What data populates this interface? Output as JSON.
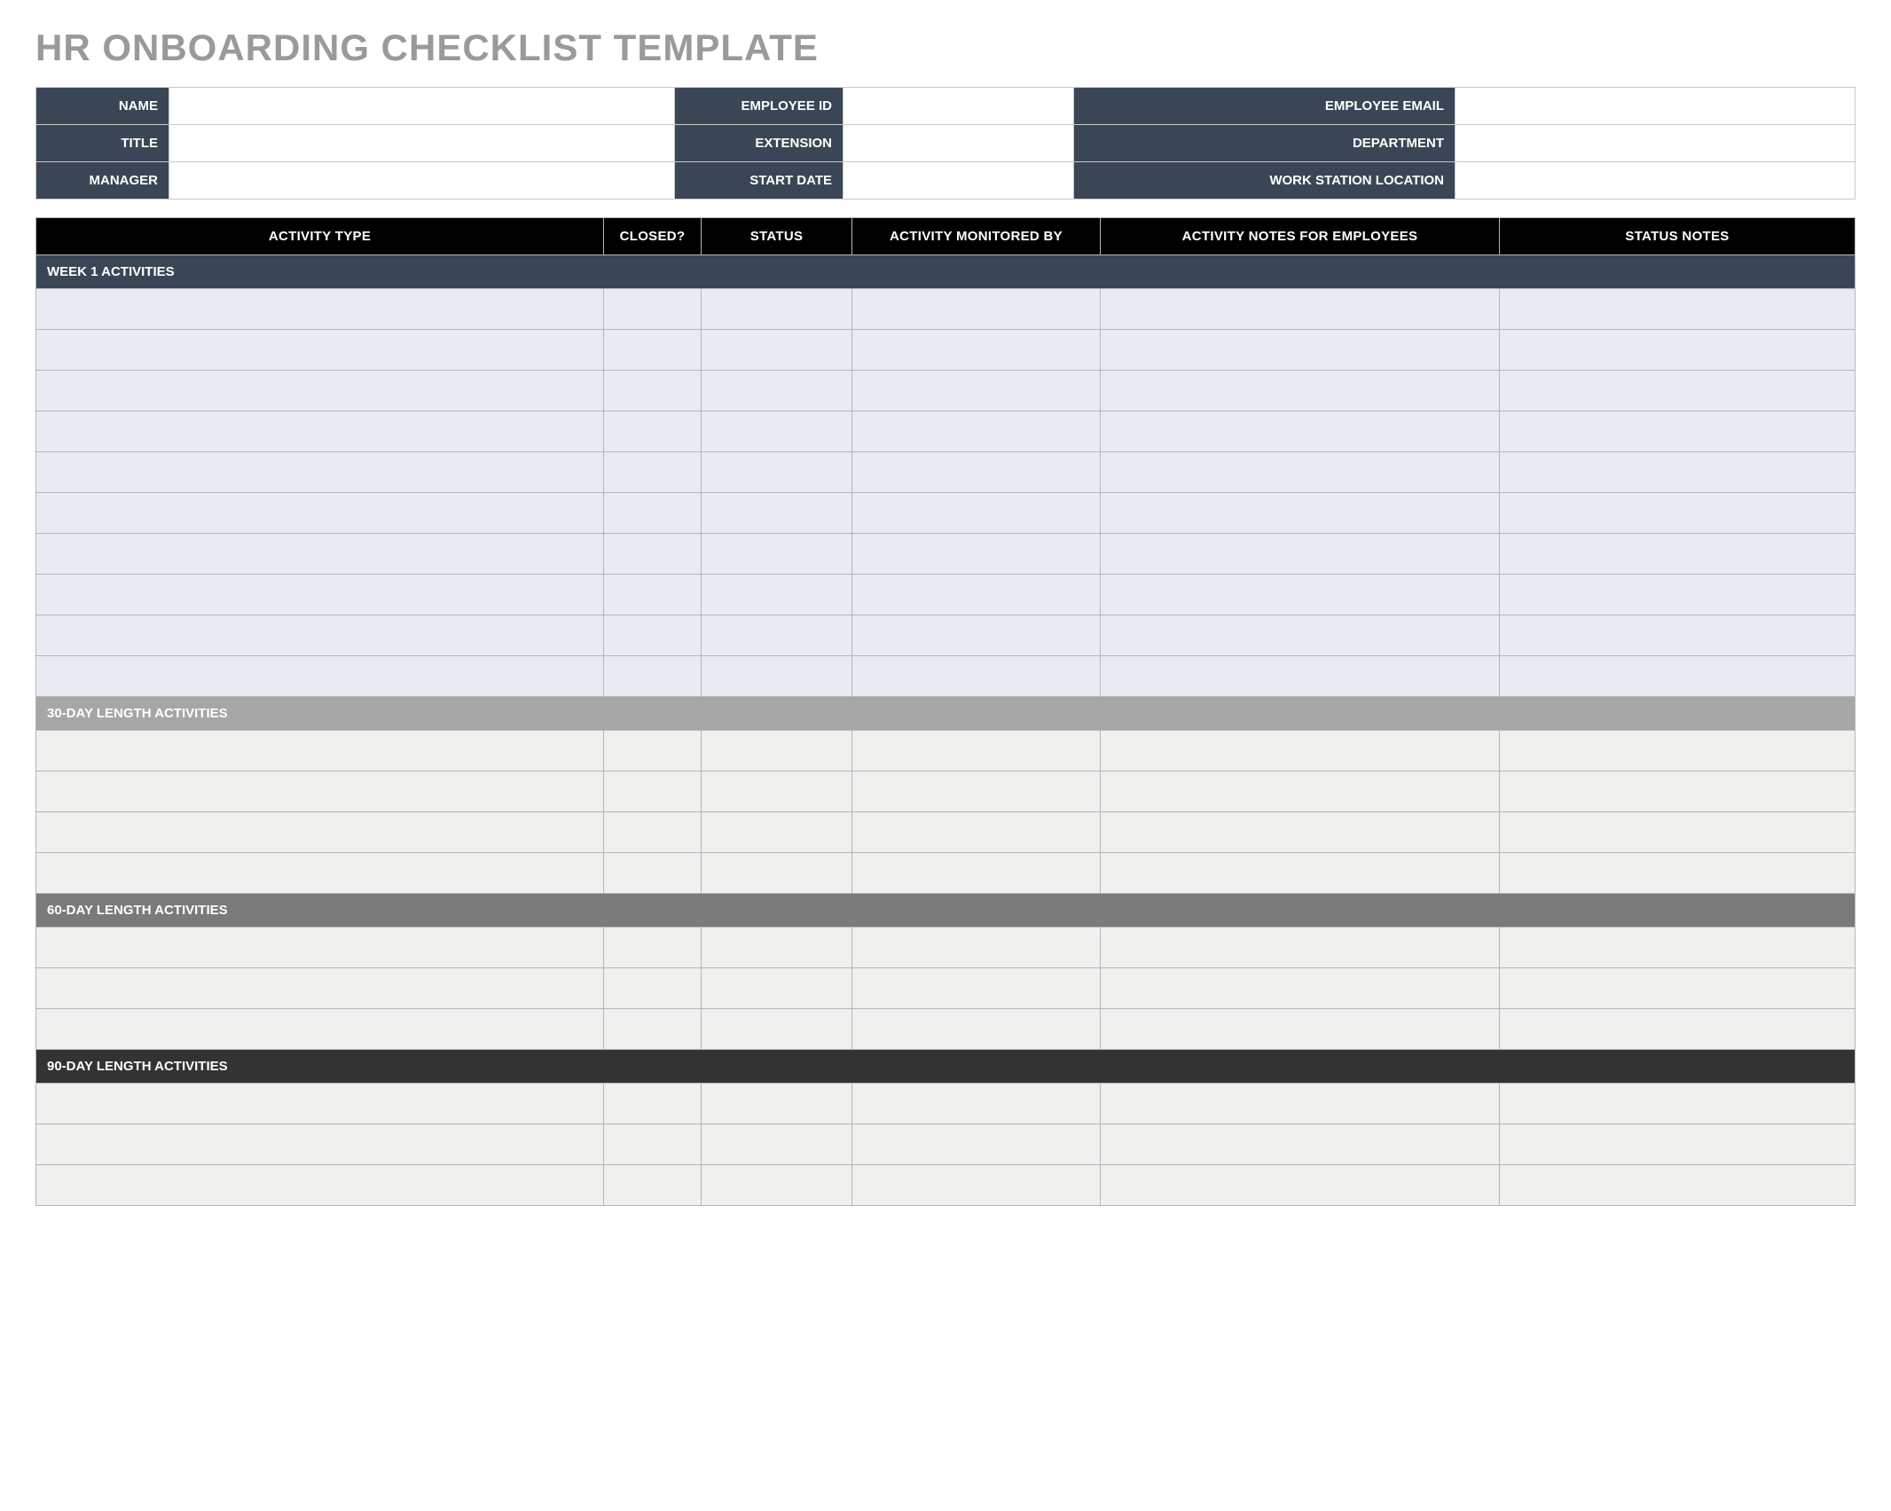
{
  "title": "HR ONBOARDING CHECKLIST TEMPLATE",
  "info": {
    "rows": [
      {
        "l1": "NAME",
        "v1": "",
        "l2": "EMPLOYEE ID",
        "v2": "",
        "l3": "EMPLOYEE EMAIL",
        "v3": ""
      },
      {
        "l1": "TITLE",
        "v1": "",
        "l2": "EXTENSION",
        "v2": "",
        "l3": "DEPARTMENT",
        "v3": ""
      },
      {
        "l1": "MANAGER",
        "v1": "",
        "l2": "START DATE",
        "v2": "",
        "l3": "WORK STATION LOCATION",
        "v3": ""
      }
    ]
  },
  "columns": {
    "activity_type": "ACTIVITY TYPE",
    "closed": "CLOSED?",
    "status": "STATUS",
    "monitored_by": "ACTIVITY MONITORED BY",
    "notes_employees": "ACTIVITY NOTES FOR EMPLOYEES",
    "status_notes": "STATUS NOTES"
  },
  "sections": {
    "week1": {
      "label": "WEEK 1 ACTIVITIES",
      "row_count": 10
    },
    "d30": {
      "label": "30-DAY LENGTH ACTIVITIES",
      "row_count": 4
    },
    "d60": {
      "label": "60-DAY LENGTH ACTIVITIES",
      "row_count": 3
    },
    "d90": {
      "label": "90-DAY LENGTH ACTIVITIES",
      "row_count": 3
    }
  }
}
